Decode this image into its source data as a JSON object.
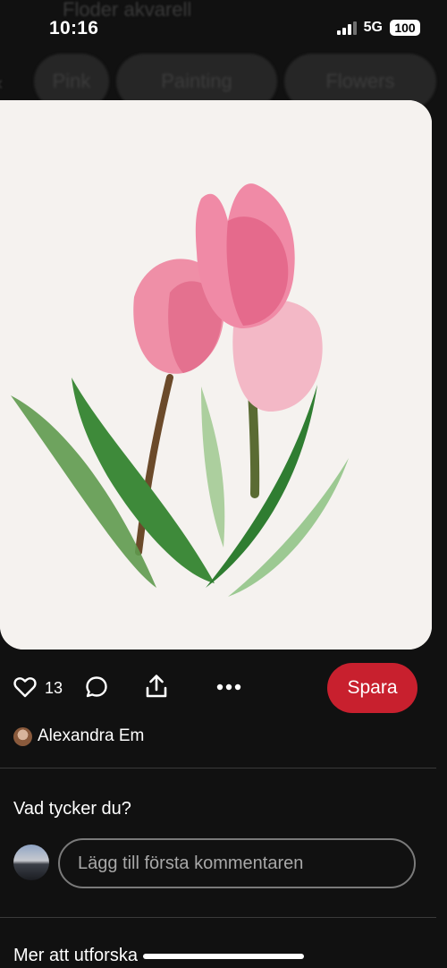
{
  "background": {
    "board_title": "Floder akvarell",
    "chips": [
      "Pink",
      "Painting",
      "Flowers"
    ]
  },
  "status_bar": {
    "time": "10:16",
    "network": "5G",
    "battery": "100"
  },
  "pin": {
    "image_alt": "Watercolor painting of pink tulips",
    "like_count": "13",
    "save_label": "Spara",
    "author_name": "Alexandra Em"
  },
  "comments": {
    "prompt": "Vad tycker du?",
    "input_placeholder": "Lägg till första kommentaren"
  },
  "more": {
    "title": "Mer att utforska"
  },
  "colors": {
    "background": "#111111",
    "save_button": "#c8202e",
    "text": "#ffffff"
  },
  "icons": [
    "heart-icon",
    "comment-icon",
    "share-icon",
    "more-icon"
  ]
}
